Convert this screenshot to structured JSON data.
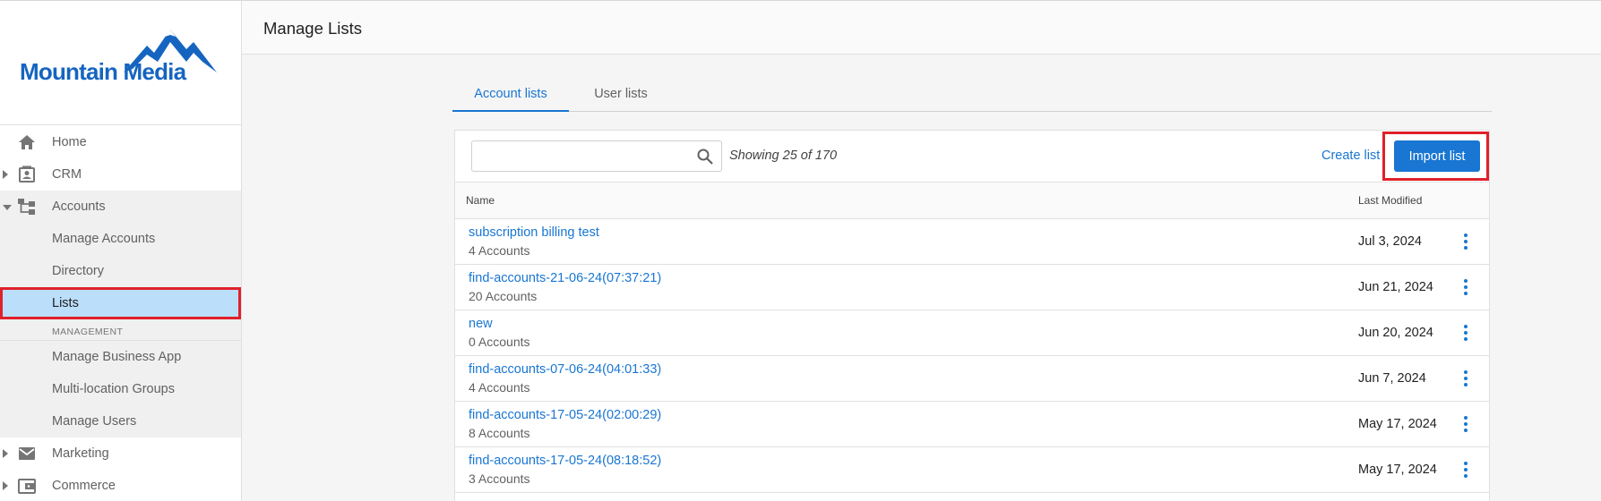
{
  "app": {
    "logo_text": "Mountain Media",
    "logo_color": "#1565c0"
  },
  "header": {
    "title": "Manage Lists"
  },
  "sidebar": {
    "items": [
      {
        "label": "Home",
        "icon": "home-icon"
      },
      {
        "label": "CRM",
        "icon": "contact-card-icon"
      },
      {
        "label": "Accounts",
        "icon": "hierarchy-icon"
      },
      {
        "label": "Manage Accounts"
      },
      {
        "label": "Directory"
      },
      {
        "label": "Lists",
        "active": true
      },
      {
        "label": "Manage Business App"
      },
      {
        "label": "Multi-location Groups"
      },
      {
        "label": "Manage Users"
      },
      {
        "label": "Marketing",
        "icon": "mail-icon"
      },
      {
        "label": "Commerce",
        "icon": "wallet-icon"
      }
    ],
    "section_label": "MANAGEMENT"
  },
  "tabs": [
    {
      "label": "Account lists",
      "active": true
    },
    {
      "label": "User lists",
      "active": false
    }
  ],
  "toolbar": {
    "search_placeholder": "",
    "search_value": "",
    "showing_text": "Showing 25 of 170",
    "create_label": "Create list",
    "import_label": "Import list"
  },
  "table": {
    "columns": [
      "Name",
      "Last Modified"
    ],
    "rows": [
      {
        "name": "subscription billing test",
        "count": "4 Accounts",
        "modified": "Jul 3, 2024"
      },
      {
        "name": "find-accounts-21-06-24(07:37:21)",
        "count": "20 Accounts",
        "modified": "Jun 21, 2024"
      },
      {
        "name": "new",
        "count": "0 Accounts",
        "modified": "Jun 20, 2024"
      },
      {
        "name": "find-accounts-07-06-24(04:01:33)",
        "count": "4 Accounts",
        "modified": "Jun 7, 2024"
      },
      {
        "name": "find-accounts-17-05-24(02:00:29)",
        "count": "8 Accounts",
        "modified": "May 17, 2024"
      },
      {
        "name": "find-accounts-17-05-24(08:18:52)",
        "count": "3 Accounts",
        "modified": "May 17, 2024"
      }
    ]
  },
  "colors": {
    "accent": "#1976d2",
    "highlight": "#e0202a",
    "active_bg": "#bbdefb"
  }
}
